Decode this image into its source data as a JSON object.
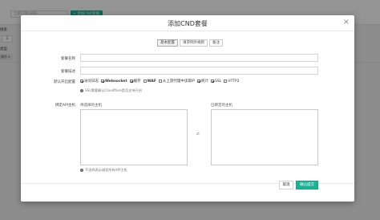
{
  "background": {
    "search_placeholder": "全部订单(UID)",
    "add_button": "+ 添加CND套餐",
    "side_label_1": "搜索",
    "side_label_2": "类型",
    "page_box": "1",
    "side_button": "操作 ▾"
  },
  "modal": {
    "title": "添加CND套餐",
    "close": "×",
    "tabs": [
      "基本配置",
      "请求例外规则",
      "备注"
    ],
    "fields": {
      "package_name_label": "套餐名称",
      "package_desc_label": "套餐描述",
      "default_config_label": "默认开启配置",
      "api_host_label": "绑定API主机"
    },
    "options": [
      {
        "label": "访问日志",
        "checked": true,
        "strong": false
      },
      {
        "label": "Websocket",
        "checked": true,
        "strong": true
      },
      {
        "label": "缓存",
        "checked": true,
        "strong": false
      },
      {
        "label": "WAF",
        "checked": false,
        "strong": true
      },
      {
        "label": "从上游代理中读取IP",
        "checked": false,
        "strong": false
      },
      {
        "label": "统计",
        "checked": true,
        "strong": false
      },
      {
        "label": "SSL",
        "checked": true,
        "strong": false
      },
      {
        "label": "HTTP2",
        "checked": false,
        "strong": false
      }
    ],
    "ssl_hint": "SSL需要确认Cloudflare是否支持开启",
    "available_hosts_title": "待选择的主机",
    "selected_hosts_title": "已绑定的主机",
    "transfer_arrow": "⇄",
    "host_hint": "不选择表示绑定所有API主机",
    "cancel_button": "取消",
    "ok_button": "确认提交"
  },
  "colors": {
    "accent": "#1ab394"
  }
}
